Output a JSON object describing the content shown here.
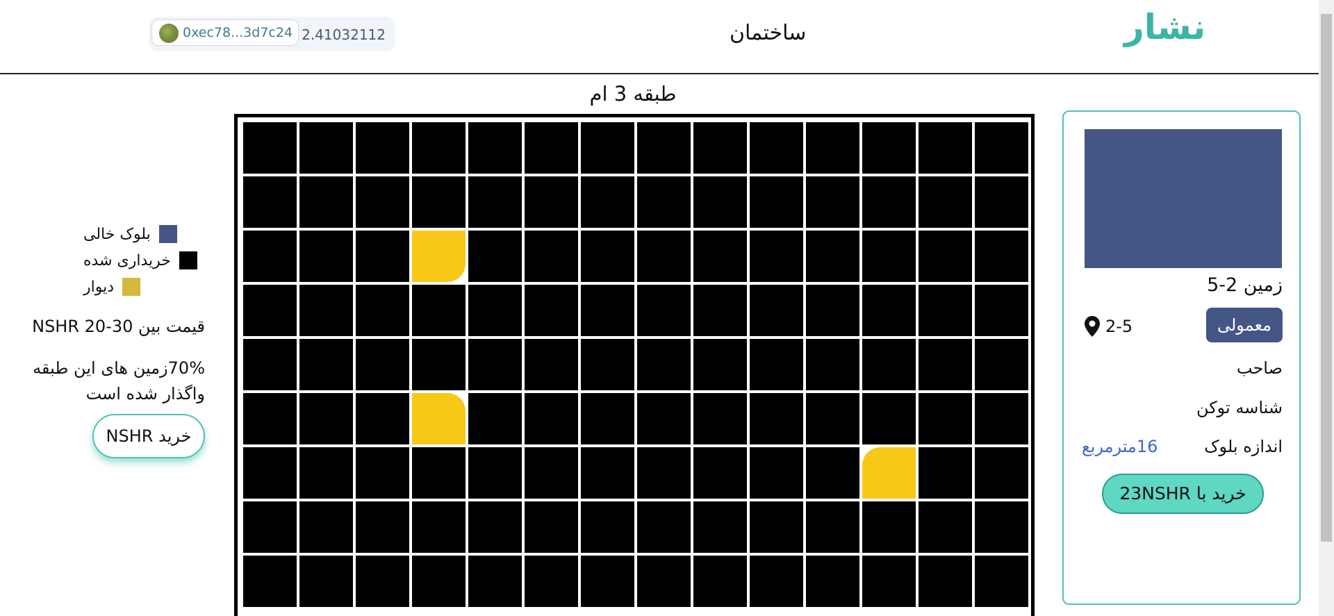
{
  "header": {
    "logo": "نشار",
    "page_title": "ساختمان",
    "wallet": {
      "balance": "2.41032112",
      "address": "0xec78...3d7c24"
    }
  },
  "floor": {
    "title": "طبقه 3 ام",
    "columns": 14,
    "rows": 9,
    "walls": [
      {
        "row": 2,
        "col": 3,
        "corner": "bottom-right"
      },
      {
        "row": 5,
        "col": 3,
        "corner": "top-right"
      },
      {
        "row": 6,
        "col": 11,
        "corner": "top-left"
      }
    ]
  },
  "legend": {
    "items": [
      {
        "label": "بلوک خالی",
        "color": "#435686"
      },
      {
        "label": "خریداری شده",
        "color": "#000000"
      },
      {
        "label": "دیوار",
        "color": "#d4b93c"
      }
    ],
    "price_range": "قیمت بین NSHR 20-30",
    "sold_text": "70%زمین های این طبقه واگذار شده است",
    "buy_button": "خرید NSHR"
  },
  "panel": {
    "land_title": "زمین 2-5",
    "type_badge": "معمولی",
    "location": "2-5",
    "owner_label": "صاحب",
    "token_label": "شناسه توکن",
    "size_label": "اندازه بلوک",
    "size_value": "16مترمربع",
    "buy_button": "خرید با 23NSHR",
    "preview_color": "#435686"
  },
  "colors": {
    "accent": "#3bb5a8",
    "empty_block": "#435686",
    "purchased": "#000000",
    "wall": "#f8c818"
  }
}
